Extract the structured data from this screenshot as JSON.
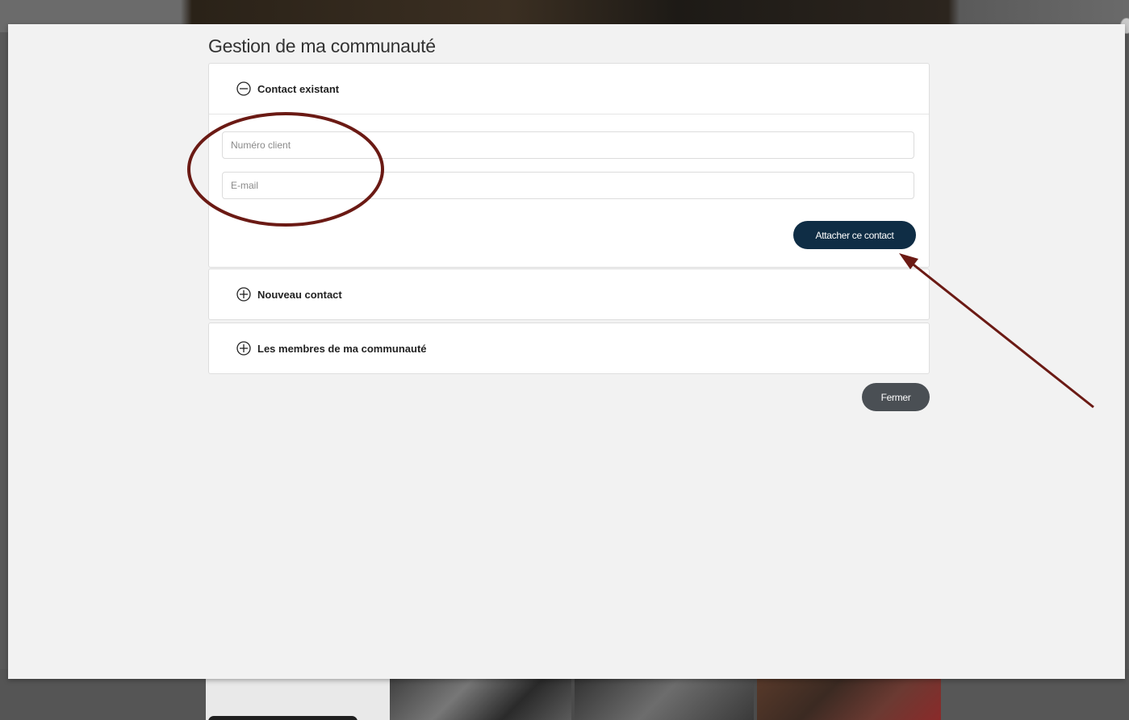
{
  "modal": {
    "title": "Gestion de ma communauté",
    "close_label": "Fermer"
  },
  "sections": {
    "existing_contact": {
      "label": "Contact existant",
      "expanded": true,
      "client_number_placeholder": "Numéro client",
      "email_placeholder": "E-mail",
      "attach_label": "Attacher ce contact"
    },
    "new_contact": {
      "label": "Nouveau contact",
      "expanded": false
    },
    "members": {
      "label": "Les membres de ma communauté",
      "expanded": false
    }
  },
  "icons": {
    "collapse": "minus-circle-icon",
    "expand": "plus-circle-icon"
  },
  "colors": {
    "primary_button": "#0f2d45",
    "secondary_button": "#4a4f54",
    "annotation": "#6b1a14",
    "modal_bg": "#f2f2f2"
  }
}
